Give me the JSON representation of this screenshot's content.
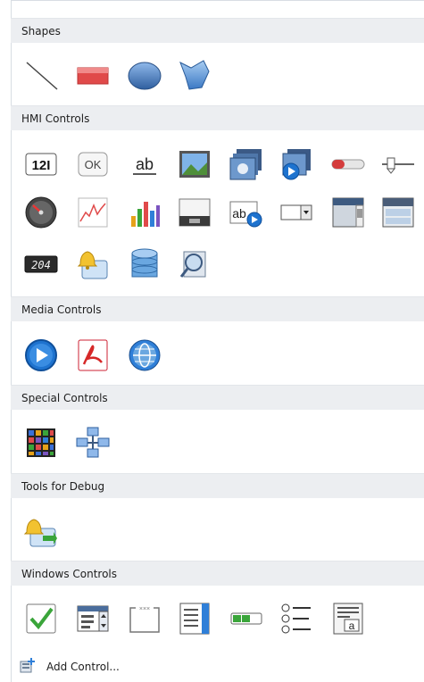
{
  "sections": [
    {
      "label": "Shapes"
    },
    {
      "label": "HMI Controls"
    },
    {
      "label": "Media Controls"
    },
    {
      "label": "Special Controls"
    },
    {
      "label": "Tools for Debug"
    },
    {
      "label": "Windows Controls"
    }
  ],
  "hmi": {
    "numeric_text": "12I",
    "ok_text": "OK",
    "text_text": "ab",
    "textedit_text": "ab",
    "digital_text": "204"
  },
  "windows": {
    "textbox_letter": "a"
  },
  "footer": {
    "add_control_label": "Add Control..."
  },
  "colors": {
    "header_bg": "#eceef1",
    "accent_blue": "#2f7fd8",
    "rect_red": "#e04a4a",
    "check_green": "#3aa53a"
  }
}
